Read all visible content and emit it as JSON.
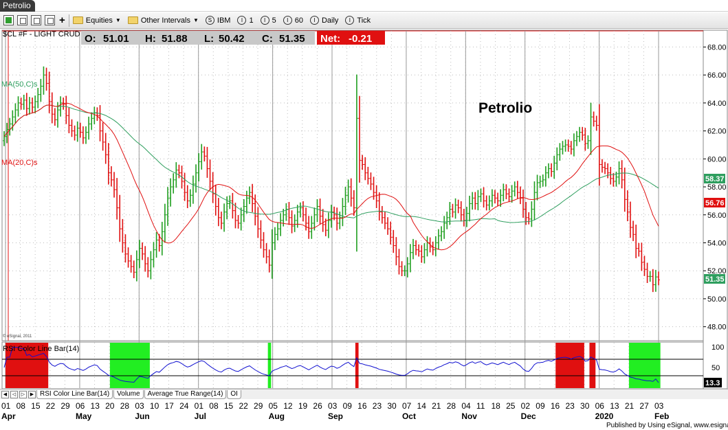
{
  "window": {
    "title": "Petrolio"
  },
  "toolbar": {
    "items": [
      {
        "label": "Equities",
        "kind": "folder",
        "dropdown": true
      },
      {
        "label": "Other Intervals",
        "kind": "folder",
        "dropdown": true
      },
      {
        "label": "IBM",
        "badge": "S"
      },
      {
        "label": "1",
        "badge": "I"
      },
      {
        "label": "5",
        "badge": "I"
      },
      {
        "label": "60",
        "badge": "I"
      },
      {
        "label": "Daily",
        "badge": "I"
      },
      {
        "label": "Tick",
        "badge": "I"
      }
    ]
  },
  "colors": {
    "up": "#1f9e1f",
    "down": "#e01010",
    "ma20": "#e01010",
    "ma50": "#2e9e5e",
    "rsi": "#1010d0",
    "grid": "#bbbbbb"
  },
  "chart_data": {
    "type": "candlestick",
    "symbol_label": "$CL #F - LIGHT CRUD",
    "annotation": "Petrolio",
    "quote": {
      "open_label": "O:",
      "open": "51.01",
      "high_label": "H:",
      "high": "51.88",
      "low_label": "L:",
      "low": "50.42",
      "close_label": "C:",
      "close": "51.35",
      "net_label": "Net:",
      "net": "-0.21"
    },
    "ma50_label": "MA(50,C)s",
    "ma20_label": "MA(20,C)s",
    "last_price_labels": {
      "ma50": "58.37",
      "ma20": "56.76",
      "close": "51.35"
    },
    "copyright": "© eSignal, 2011",
    "ylim": [
      47.0,
      69.2
    ],
    "y_ticks": [
      "68.00",
      "66.00",
      "64.00",
      "62.00",
      "60.00",
      "58.00",
      "56.00",
      "54.00",
      "52.00",
      "50.00",
      "48.00"
    ],
    "y_tick_values": [
      68,
      66,
      64,
      62,
      60,
      58,
      56,
      54,
      52,
      50,
      48
    ],
    "x_date_ticks": [
      "01",
      "08",
      "15",
      "22",
      "29",
      "06",
      "13",
      "20",
      "28",
      "03",
      "10",
      "17",
      "24",
      "01",
      "08",
      "15",
      "22",
      "29",
      "05",
      "12",
      "19",
      "26",
      "03",
      "09",
      "16",
      "23",
      "30",
      "07",
      "14",
      "21",
      "28",
      "04",
      "11",
      "18",
      "25",
      "02",
      "09",
      "16",
      "23",
      "30",
      "06",
      "13",
      "21",
      "27",
      "03"
    ],
    "x_months": [
      {
        "label": "Apr",
        "tick": 0
      },
      {
        "label": "May",
        "tick": 5
      },
      {
        "label": "Jun",
        "tick": 9
      },
      {
        "label": "Jul",
        "tick": 13
      },
      {
        "label": "Aug",
        "tick": 18
      },
      {
        "label": "Sep",
        "tick": 22
      },
      {
        "label": "Oct",
        "tick": 27
      },
      {
        "label": "Nov",
        "tick": 31
      },
      {
        "label": "Dec",
        "tick": 35
      },
      {
        "label": "2020",
        "tick": 40
      },
      {
        "label": "Feb",
        "tick": 44
      }
    ],
    "closes": [
      61.6,
      62.1,
      62.5,
      63.0,
      63.5,
      64.0,
      63.9,
      64.2,
      63.6,
      64.0,
      63.7,
      64.1,
      64.6,
      65.2,
      66.0,
      65.4,
      64.1,
      63.2,
      62.8,
      63.5,
      64.0,
      63.9,
      63.1,
      62.4,
      62.0,
      61.7,
      62.2,
      61.9,
      61.5,
      61.9,
      62.5,
      62.9,
      63.3,
      63.1,
      62.0,
      61.2,
      60.3,
      59.0,
      58.5,
      57.8,
      56.5,
      55.0,
      54.0,
      53.2,
      52.7,
      52.3,
      51.9,
      52.8,
      53.6,
      53.2,
      52.5,
      52.0,
      52.8,
      53.5,
      54.2,
      53.8,
      54.8,
      56.0,
      57.2,
      58.0,
      58.5,
      59.2,
      59.0,
      58.4,
      57.6,
      57.0,
      57.4,
      58.2,
      59.0,
      59.8,
      60.5,
      60.2,
      59.3,
      58.4,
      57.5,
      56.6,
      55.8,
      55.4,
      56.2,
      56.8,
      57.0,
      56.3,
      55.6,
      55.4,
      56.0,
      56.6,
      57.2,
      57.6,
      56.8,
      55.9,
      55.0,
      54.2,
      53.5,
      53.0,
      52.4,
      54.0,
      54.6,
      55.0,
      55.6,
      56.0,
      56.4,
      55.8,
      55.2,
      55.6,
      56.2,
      56.5,
      56.0,
      55.4,
      54.8,
      55.4,
      56.0,
      56.6,
      55.9,
      55.3,
      54.9,
      55.6,
      56.2,
      56.0,
      55.4,
      55.8,
      56.6,
      57.4,
      58.0,
      57.2,
      56.5,
      62.9,
      59.9,
      59.6,
      59.0,
      58.6,
      58.2,
      57.6,
      57.0,
      56.2,
      55.8,
      55.4,
      55.0,
      54.4,
      53.8,
      53.0,
      52.3,
      52.0,
      52.0,
      52.5,
      53.3,
      53.8,
      53.5,
      53.4,
      53.0,
      53.5,
      54.0,
      53.7,
      53.5,
      54.0,
      54.5,
      54.8,
      55.4,
      55.8,
      56.4,
      56.2,
      56.7,
      56.5,
      56.0,
      55.6,
      56.1,
      56.8,
      57.2,
      56.8,
      57.3,
      57.5,
      57.0,
      56.7,
      57.0,
      57.4,
      57.2,
      57.0,
      57.4,
      57.8,
      57.5,
      57.3,
      57.7,
      58.0,
      57.6,
      57.2,
      56.4,
      55.8,
      55.7,
      56.4,
      57.6,
      58.3,
      58.4,
      58.5,
      59.0,
      59.3,
      59.1,
      59.7,
      60.3,
      60.7,
      60.9,
      61.0,
      60.9,
      60.7,
      61.3,
      61.6,
      61.9,
      61.7,
      61.1,
      61.3,
      63.0,
      62.7,
      62.4,
      59.6,
      59.4,
      59.3,
      59.0,
      58.6,
      58.4,
      58.7,
      59.3,
      58.5,
      57.1,
      56.2,
      55.1,
      54.6,
      53.6,
      53.4,
      52.6,
      52.1,
      51.6,
      51.6,
      51.0,
      51.56,
      51.35
    ],
    "rsi": {
      "label": "RSI Color Line Bar(14)",
      "ylim": [
        0,
        110
      ],
      "y_ticks": [
        "100",
        "50"
      ],
      "y_tick_values": [
        100,
        50
      ],
      "bands": [
        70,
        30
      ],
      "last_label": "13.3"
    }
  },
  "study_tabs": [
    "RSI Color Line Bar(14)",
    "Volume",
    "Average True Range(14)",
    "OI"
  ],
  "footer": {
    "credit": "Published by Using eSignal, www.esignal.com"
  }
}
